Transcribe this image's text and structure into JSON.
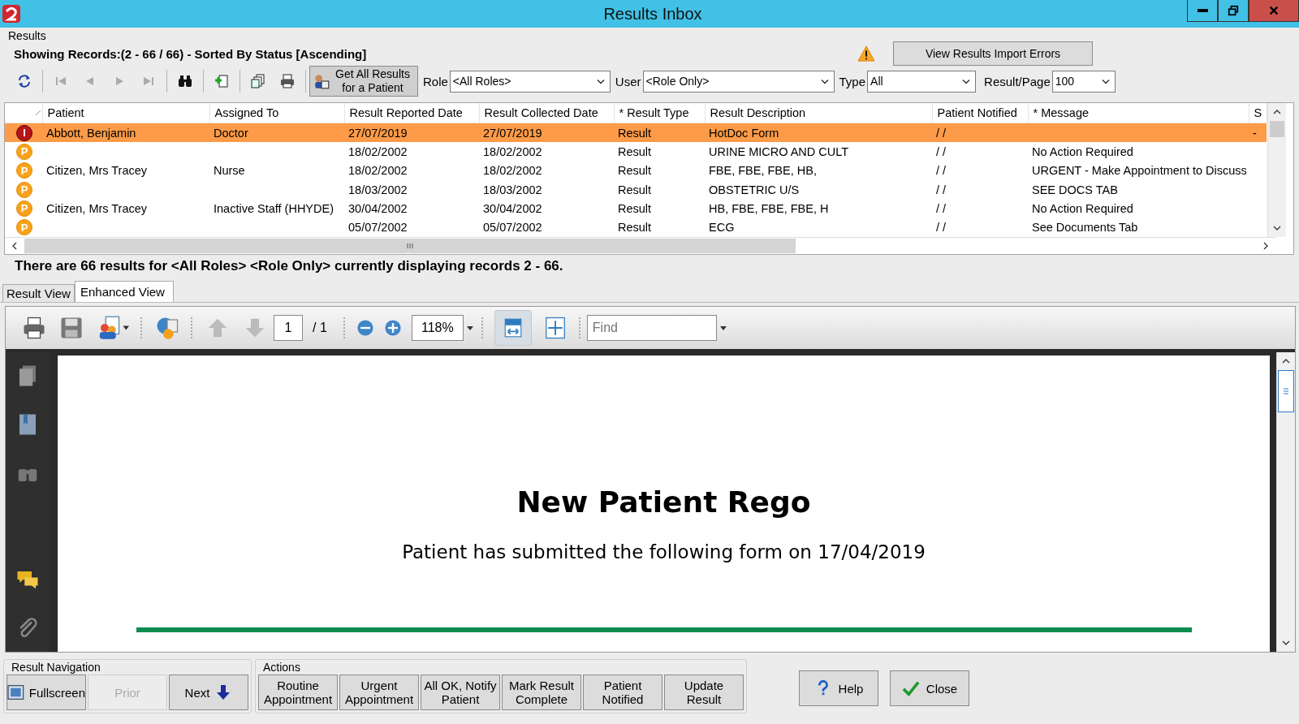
{
  "window": {
    "title": "Results Inbox"
  },
  "results_panel": {
    "label": "Results",
    "summary": "Showing Records:(2 - 66 / 66) - Sorted By Status [Ascending]",
    "import_errors_button": "View Results Import Errors"
  },
  "toolbar": {
    "get_all_button": "Get All Results for a Patient",
    "filters": [
      {
        "label": "Role",
        "value": "<All Roles>"
      },
      {
        "label": "User",
        "value": "<Role Only>"
      },
      {
        "label": "Type",
        "value": "All"
      },
      {
        "label": "Result/Page",
        "value": "100"
      }
    ]
  },
  "table": {
    "columns": [
      "Patient",
      "Assigned To",
      "Result Reported Date",
      "Result Collected Date",
      "* Result Type",
      "Result Description",
      "Patient Notified",
      "* Message",
      "S"
    ],
    "rows": [
      {
        "status": "I",
        "kind": "urgent",
        "selected": true,
        "cells": [
          "Abbott, Benjamin",
          "Doctor",
          "27/07/2019",
          "27/07/2019",
          "Result",
          "HotDoc Form",
          "/ /",
          "",
          "-"
        ]
      },
      {
        "status": "P",
        "kind": "pending",
        "selected": false,
        "cells": [
          "",
          "",
          "18/02/2002",
          "18/02/2002",
          "Result",
          "URINE MICRO AND CULT",
          "/ /",
          "No Action Required",
          ""
        ]
      },
      {
        "status": "P",
        "kind": "pending",
        "selected": false,
        "cells": [
          "Citizen, Mrs Tracey",
          "Nurse",
          "18/02/2002",
          "18/02/2002",
          "Result",
          "FBE, FBE, FBE, HB,",
          "/ /",
          "URGENT - Make Appointment to Discuss",
          ""
        ]
      },
      {
        "status": "P",
        "kind": "pending",
        "selected": false,
        "cells": [
          "",
          "",
          "18/03/2002",
          "18/03/2002",
          "Result",
          "OBSTETRIC U/S",
          "/ /",
          "SEE DOCS TAB",
          ""
        ]
      },
      {
        "status": "P",
        "kind": "pending",
        "selected": false,
        "cells": [
          "Citizen, Mrs Tracey",
          "Inactive Staff (HHYDE)",
          "30/04/2002",
          "30/04/2002",
          "Result",
          "HB, FBE, FBE, FBE, H",
          "/ /",
          "No Action Required",
          ""
        ]
      },
      {
        "status": "P",
        "kind": "pending",
        "selected": false,
        "cells": [
          "",
          "",
          "05/07/2002",
          "05/07/2002",
          "Result",
          "ECG",
          "/ /",
          "See Documents Tab",
          ""
        ]
      }
    ]
  },
  "status_text": "There are 66 results for <All Roles> <Role Only> currently displaying records 2 - 66.",
  "tabs": [
    {
      "label": "Result View",
      "selected": false
    },
    {
      "label": "Enhanced View",
      "selected": true
    }
  ],
  "viewer": {
    "page": "1",
    "page_total": "/ 1",
    "zoom": "118%",
    "find_placeholder": "Find",
    "document": {
      "title": "New Patient Rego",
      "text": "Patient has submitted the following form on 17/04/2019"
    }
  },
  "navigation": {
    "label": "Result Navigation",
    "buttons": [
      {
        "kind": "fullscreen",
        "label": "Fullscreen",
        "disabled": false
      },
      {
        "kind": "prior",
        "label": "Prior",
        "disabled": true
      },
      {
        "kind": "next",
        "label": "Next",
        "disabled": false
      }
    ]
  },
  "actions": {
    "label": "Actions",
    "buttons": [
      "Routine Appointment",
      "Urgent Appointment",
      "All OK, Notify Patient",
      "Mark Result Complete",
      "Patient Notified",
      "Update Result"
    ]
  },
  "footer_buttons": [
    {
      "kind": "help",
      "label": "Help"
    },
    {
      "kind": "close",
      "label": "Close"
    }
  ]
}
